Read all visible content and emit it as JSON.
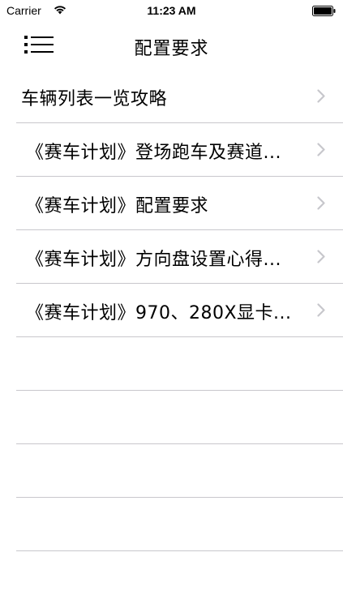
{
  "status_bar": {
    "carrier": "Carrier",
    "time": "11:23 AM"
  },
  "nav": {
    "title": "配置要求",
    "menu_icon": "menu-list-icon"
  },
  "list": {
    "items": [
      {
        "label": "车辆列表一览攻略"
      },
      {
        "label": "《赛车计划》登场跑车及赛道..."
      },
      {
        "label": "《赛车计划》配置要求"
      },
      {
        "label": "《赛车计划》方向盘设置心得..."
      },
      {
        "label": "《赛车计划》970、280X显卡..."
      }
    ],
    "chevron_color": "#c7c7cc",
    "separator_color": "#c8c7cc"
  }
}
